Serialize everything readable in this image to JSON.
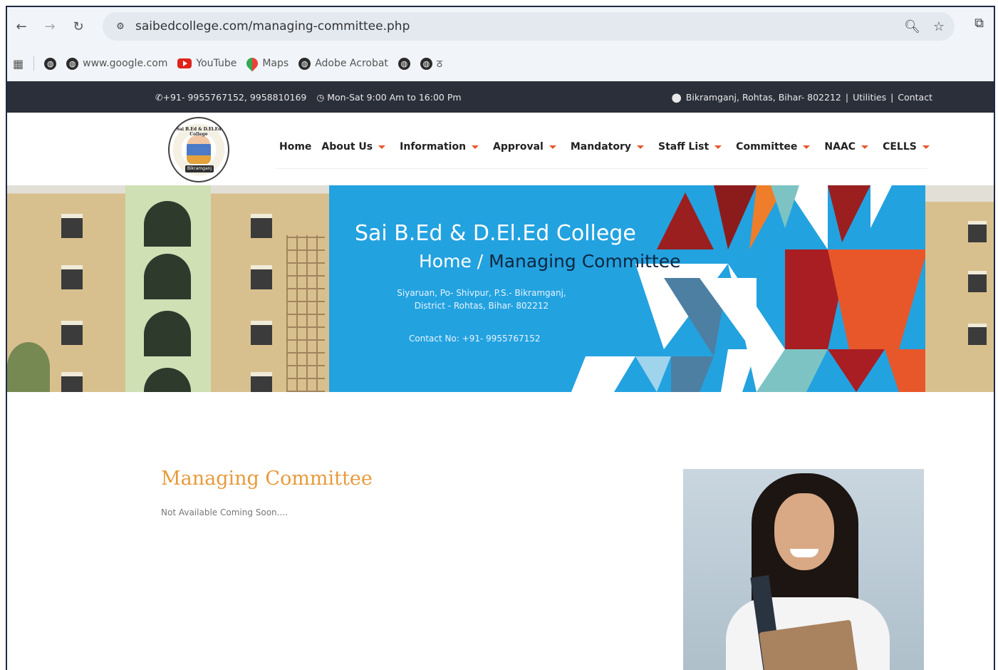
{
  "browser": {
    "url": "saibedcollege.com/managing-committee.php",
    "bookmarks": [
      {
        "label": "www.google.com",
        "icon": "globe-icon"
      },
      {
        "label": "YouTube",
        "icon": "youtube-icon"
      },
      {
        "label": "Maps",
        "icon": "maps-icon"
      },
      {
        "label": "Adobe Acrobat",
        "icon": "globe-icon"
      },
      {
        "label": "ठ",
        "icon": "globe-icon"
      }
    ]
  },
  "topbar": {
    "phone": "+91- 9955767152, 9958810169",
    "hours": "Mon-Sat 9:00 Am to 16:00 Pm",
    "location": "Bikramganj, Rohtas, Bihar- 802212",
    "sep": "|",
    "utilities": "Utilities",
    "contact": "Contact"
  },
  "logo": {
    "ring_text": "Sai B.Ed & D.El.Ed College",
    "bottom_text": "Bikramganj"
  },
  "menu": [
    {
      "label": "Home",
      "dropdown": false
    },
    {
      "label": "About Us",
      "dropdown": true
    },
    {
      "label": "Information",
      "dropdown": true
    },
    {
      "label": "Approval",
      "dropdown": true
    },
    {
      "label": "Mandatory",
      "dropdown": true
    },
    {
      "label": "Staff List",
      "dropdown": true
    },
    {
      "label": "Committee",
      "dropdown": true
    },
    {
      "label": "NAAC",
      "dropdown": true
    },
    {
      "label": "CELLS",
      "dropdown": true
    }
  ],
  "banner": {
    "title": "Sai B.Ed & D.El.Ed College",
    "crumb_home": "Home",
    "crumb_sep": "/",
    "crumb_current": "Managing Committee",
    "address_line1": "Siyaruan, Po- Shivpur, P.S.- Bikramganj,",
    "address_line2": "District - Rohtas, Bihar- 802212",
    "contact": "Contact No: +91- 9955767152"
  },
  "content": {
    "title": "Managing Committee",
    "text": "Not Available Coming Soon...."
  },
  "colors": {
    "topbar_bg": "#2b2f3a",
    "banner_blue": "#23a2e0",
    "accent_orange": "#e89a3c",
    "caret_orange": "#e8572a"
  }
}
